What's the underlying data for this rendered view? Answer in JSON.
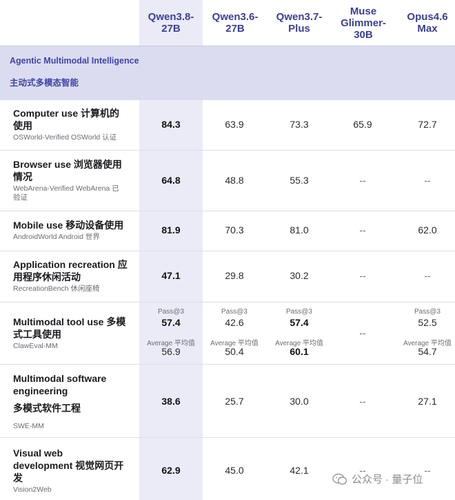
{
  "columns": [
    {
      "label": "Qwen3.8-\n27B"
    },
    {
      "label": "Qwen3.6-\n27B"
    },
    {
      "label": "Qwen3.7-\nPlus"
    },
    {
      "label": "Muse\nGlimmer-\n30B"
    },
    {
      "label": "Opus4.6\nMax"
    }
  ],
  "section": {
    "title_en": "Agentic Multimodal Intelligence",
    "title_zh": "主动式多模态智能"
  },
  "rows": [
    {
      "title": "Computer use  计算机的\n使用",
      "sub": "OSWorld-Verified  OSWorld 认证",
      "values": [
        "84.3",
        "63.9",
        "73.3",
        "65.9",
        "72.7"
      ]
    },
    {
      "title": "Browser use  浏览器使用\n情况",
      "sub": "WebArena-Verified  WebArena 已\n验证",
      "values": [
        "64.8",
        "48.8",
        "55.3",
        "--",
        "--"
      ]
    },
    {
      "title": "Mobile use  移动设备使用",
      "sub": "AndroidWorld  Android 世界",
      "values": [
        "81.9",
        "70.3",
        "81.0",
        "--",
        "62.0"
      ]
    },
    {
      "title": "Application recreation  应\n用程序休闲活动",
      "sub": "RecreationBench  休闲座椅",
      "values": [
        "47.1",
        "29.8",
        "30.2",
        "--",
        "--"
      ]
    },
    {
      "title": "Multimodal tool use  多模\n式工具使用",
      "sub": "ClawEval-MM",
      "pass_label": "Pass@3",
      "avg_label": "Average  平均值",
      "pass_values": [
        "57.4",
        "42.6",
        "57.4",
        "--",
        "52.5"
      ],
      "avg_values": [
        "56.9",
        "50.4",
        "60.1",
        "",
        "54.7"
      ]
    },
    {
      "title": "Multimodal software\nengineering",
      "title_zh": "多模式软件工程",
      "sub": "SWE-MM",
      "values": [
        "38.6",
        "25.7",
        "30.0",
        "--",
        "27.1"
      ]
    },
    {
      "title": "Visual web\ndevelopment  视觉网页开\n发",
      "sub": "Vision2Web",
      "values": [
        "62.9",
        "45.0",
        "42.1",
        "--",
        "--"
      ]
    }
  ],
  "watermark": {
    "text": "公众号 · 量子位",
    "icon": "wechat-icon"
  },
  "colors": {
    "accent": "#3a3f96",
    "band": "#dcdcf1",
    "highlight_col": "#ebebf7"
  }
}
